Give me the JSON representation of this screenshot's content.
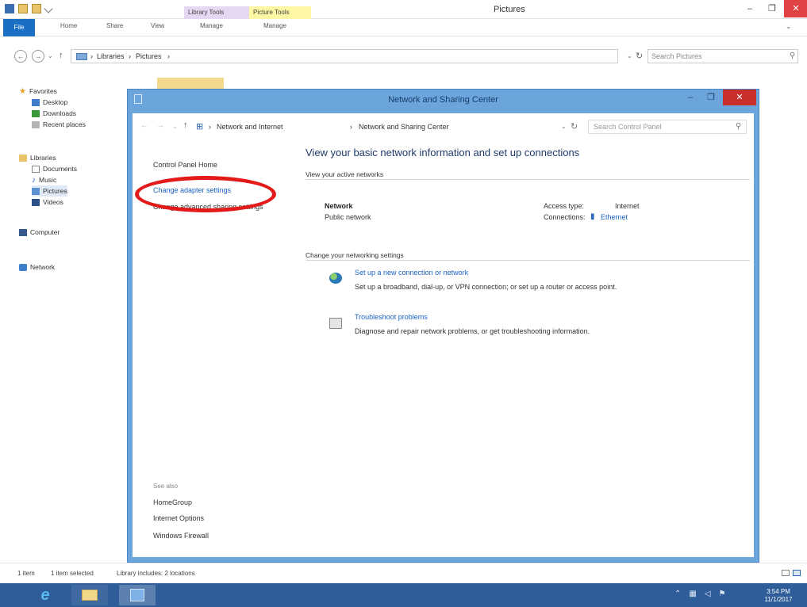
{
  "explorer": {
    "title": "Pictures",
    "context_tabs": [
      "Library Tools",
      "Picture Tools"
    ],
    "ribbon_tabs": [
      "File",
      "Home",
      "Share",
      "View",
      "Manage",
      "Manage"
    ],
    "breadcrumb": [
      "Libraries",
      "Pictures"
    ],
    "search_placeholder": "Search Pictures",
    "nav": {
      "favorites": "Favorites",
      "desktop": "Desktop",
      "downloads": "Downloads",
      "recent": "Recent places",
      "libraries": "Libraries",
      "documents": "Documents",
      "music": "Music",
      "pictures": "Pictures",
      "videos": "Videos",
      "computer": "Computer",
      "network": "Network"
    },
    "status": {
      "count": "1 item",
      "selected": "1 item selected",
      "library_info": "Library includes: 2 locations"
    }
  },
  "nsc": {
    "title": "Network and Sharing Center",
    "breadcrumb": [
      "Network and Internet",
      "Network and Sharing Center"
    ],
    "search_placeholder": "Search Control Panel",
    "left": {
      "home": "Control Panel Home",
      "adapter": "Change adapter settings",
      "advanced": "Change advanced sharing settings",
      "see_also_title": "See also",
      "see_also": [
        "HomeGroup",
        "Internet Options",
        "Windows Firewall"
      ]
    },
    "main": {
      "heading": "View your basic network information and set up connections",
      "active_title": "View your active networks",
      "network_name": "Network",
      "network_type": "Public network",
      "access_label": "Access type:",
      "access_value": "Internet",
      "connections_label": "Connections:",
      "connection_link": "Ethernet",
      "change_title": "Change your networking settings",
      "task1_link": "Set up a new connection or network",
      "task1_desc": "Set up a broadband, dial-up, or VPN connection; or set up a router or access point.",
      "task2_link": "Troubleshoot problems",
      "task2_desc": "Diagnose and repair network problems, or get troubleshooting information."
    }
  },
  "taskbar": {
    "clock_time": "3:54 PM",
    "clock_date": "11/1/2017"
  },
  "colors": {
    "accent": "#1a62c4",
    "nsc_frame": "#6ca5db",
    "close_red": "#c9302c",
    "highlight": "#e21a1a",
    "taskbar": "#2f5d9a"
  }
}
